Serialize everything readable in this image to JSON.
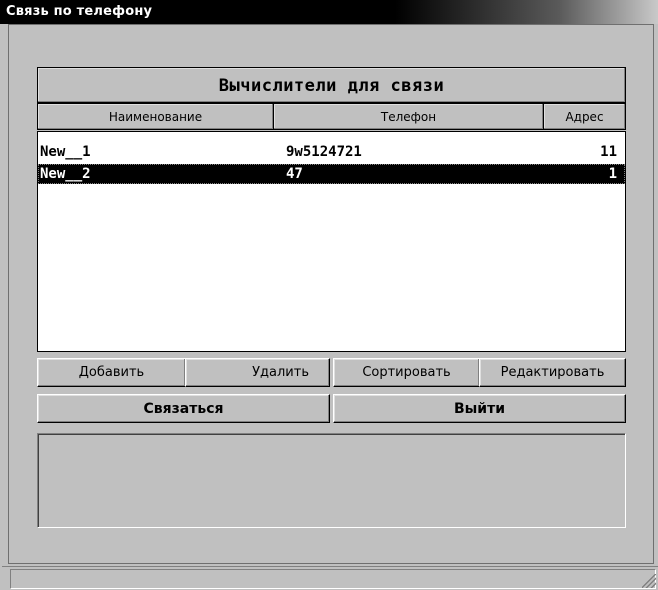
{
  "window": {
    "title": "Связь по телефону"
  },
  "list": {
    "caption": "Вычислители для связи",
    "columns": {
      "name": "Наименование",
      "phone": "Телефон",
      "address": "Адрес"
    },
    "rows": [
      {
        "name": "New__1",
        "phone": "9w5124721",
        "address": "11",
        "selected": false
      },
      {
        "name": "New__2",
        "phone": "47",
        "address": "1",
        "selected": true
      }
    ]
  },
  "buttons": {
    "add": "Добавить",
    "delete": "Удалить",
    "sort": "Сортировать",
    "edit": "Редактировать",
    "connect": "Связаться",
    "exit": "Выйти"
  },
  "colors": {
    "face": "#c0c0c0",
    "selection": "#000000",
    "title_text": "#ffffff"
  }
}
